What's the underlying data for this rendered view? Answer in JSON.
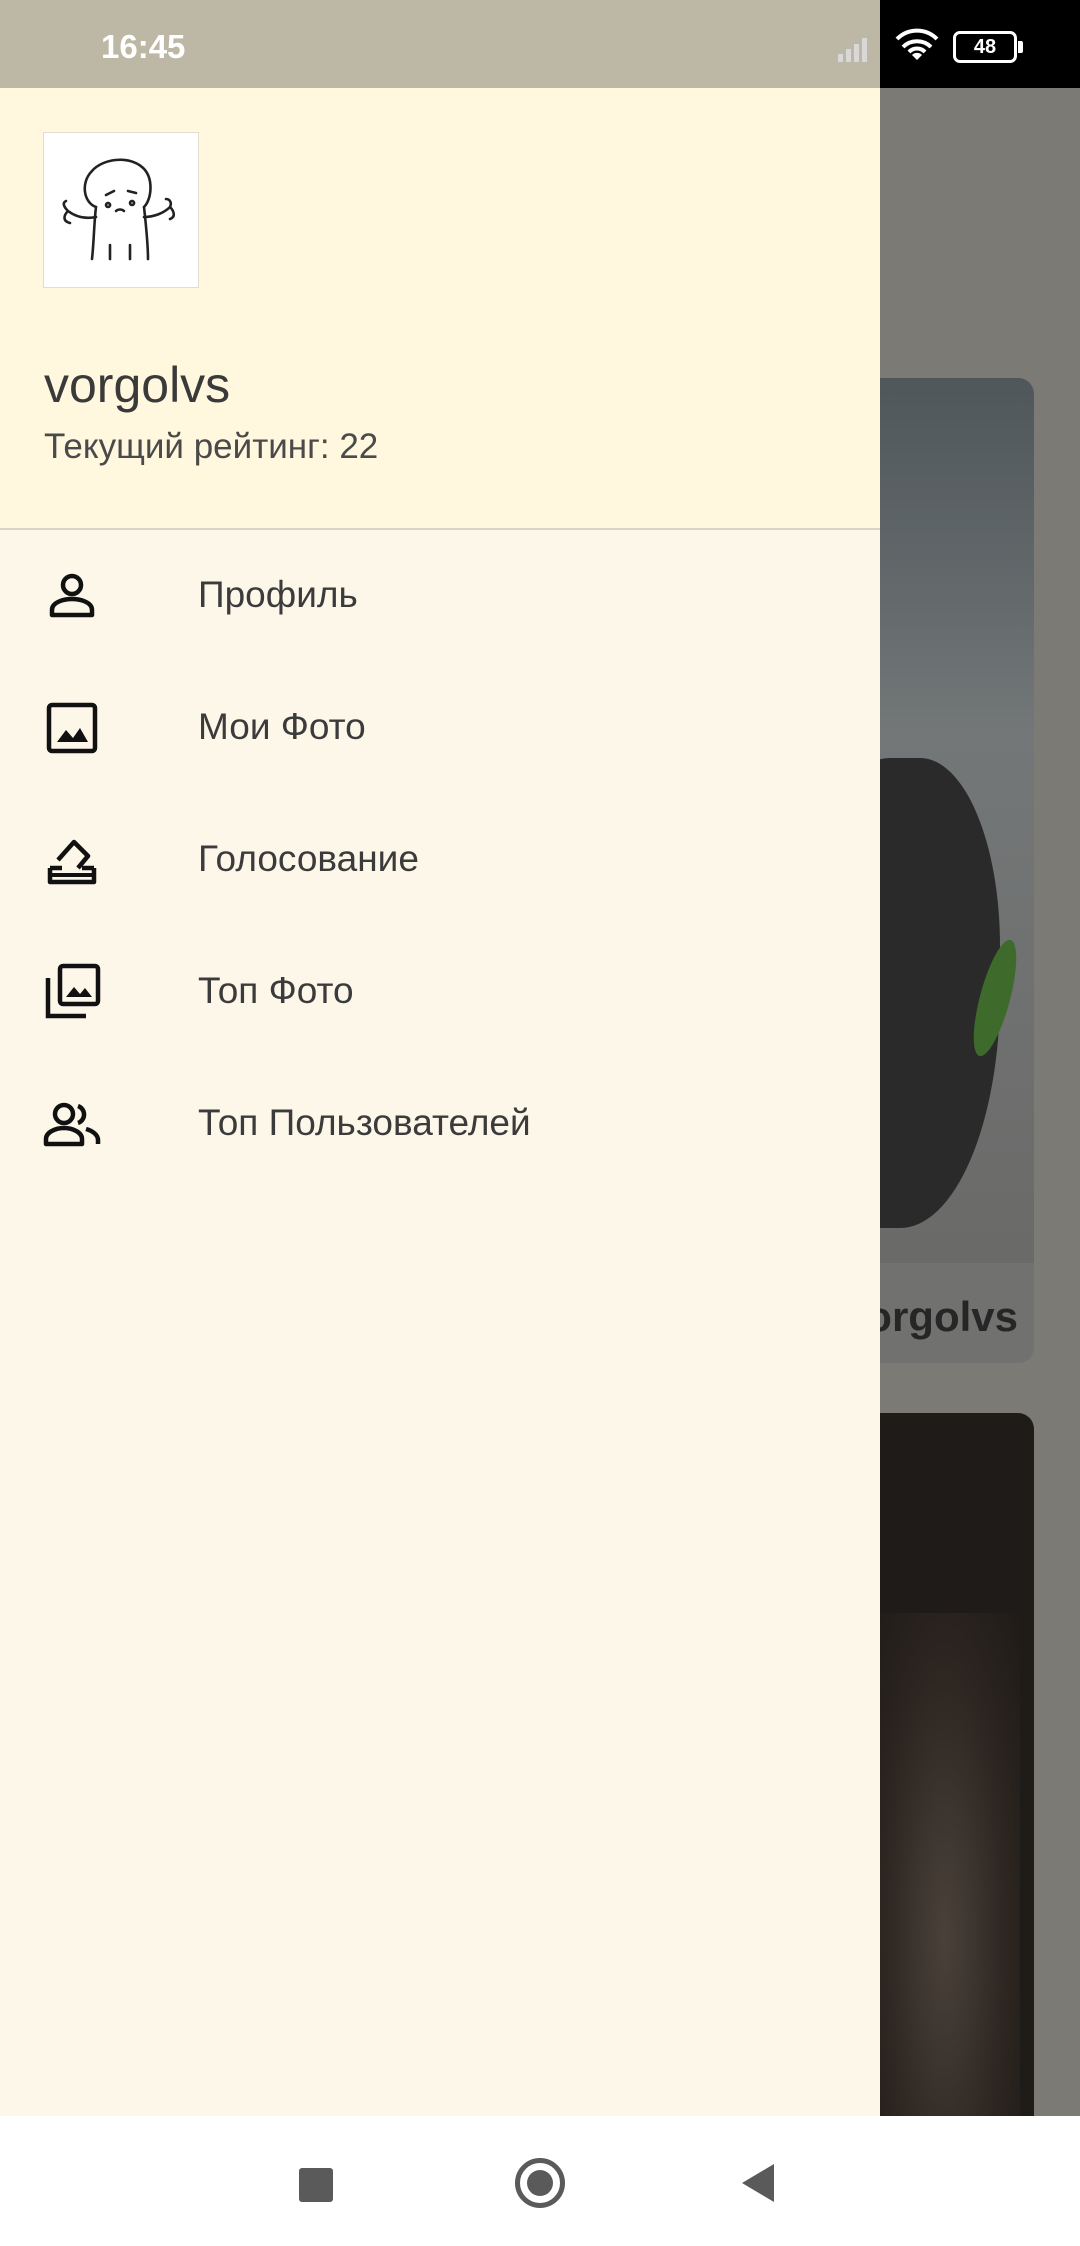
{
  "status_bar": {
    "time": "16:45",
    "battery": "48",
    "icons": [
      "signal-icon",
      "wifi-icon",
      "battery-icon"
    ]
  },
  "background": {
    "card_author": "vorgolvs"
  },
  "drawer": {
    "header": {
      "username": "vorgolvs",
      "rating": "Текущий рейтинг: 22"
    },
    "menu": [
      {
        "label": "Профиль",
        "icon": "person-icon"
      },
      {
        "label": "Мои Фото",
        "icon": "image-icon"
      },
      {
        "label": "Голосование",
        "icon": "vote-icon"
      },
      {
        "label": "Топ Фото",
        "icon": "photo-library-icon"
      },
      {
        "label": "Топ Пользователей",
        "icon": "people-icon"
      }
    ]
  },
  "nav_bar": {
    "buttons": [
      "recents-button",
      "home-button",
      "back-button"
    ]
  },
  "colors": {
    "drawer_header_bg": "#fff8df",
    "drawer_bg": "#fdf7ea",
    "text": "#3b3b3b",
    "status_bar_bg": "#bdb8a6"
  }
}
